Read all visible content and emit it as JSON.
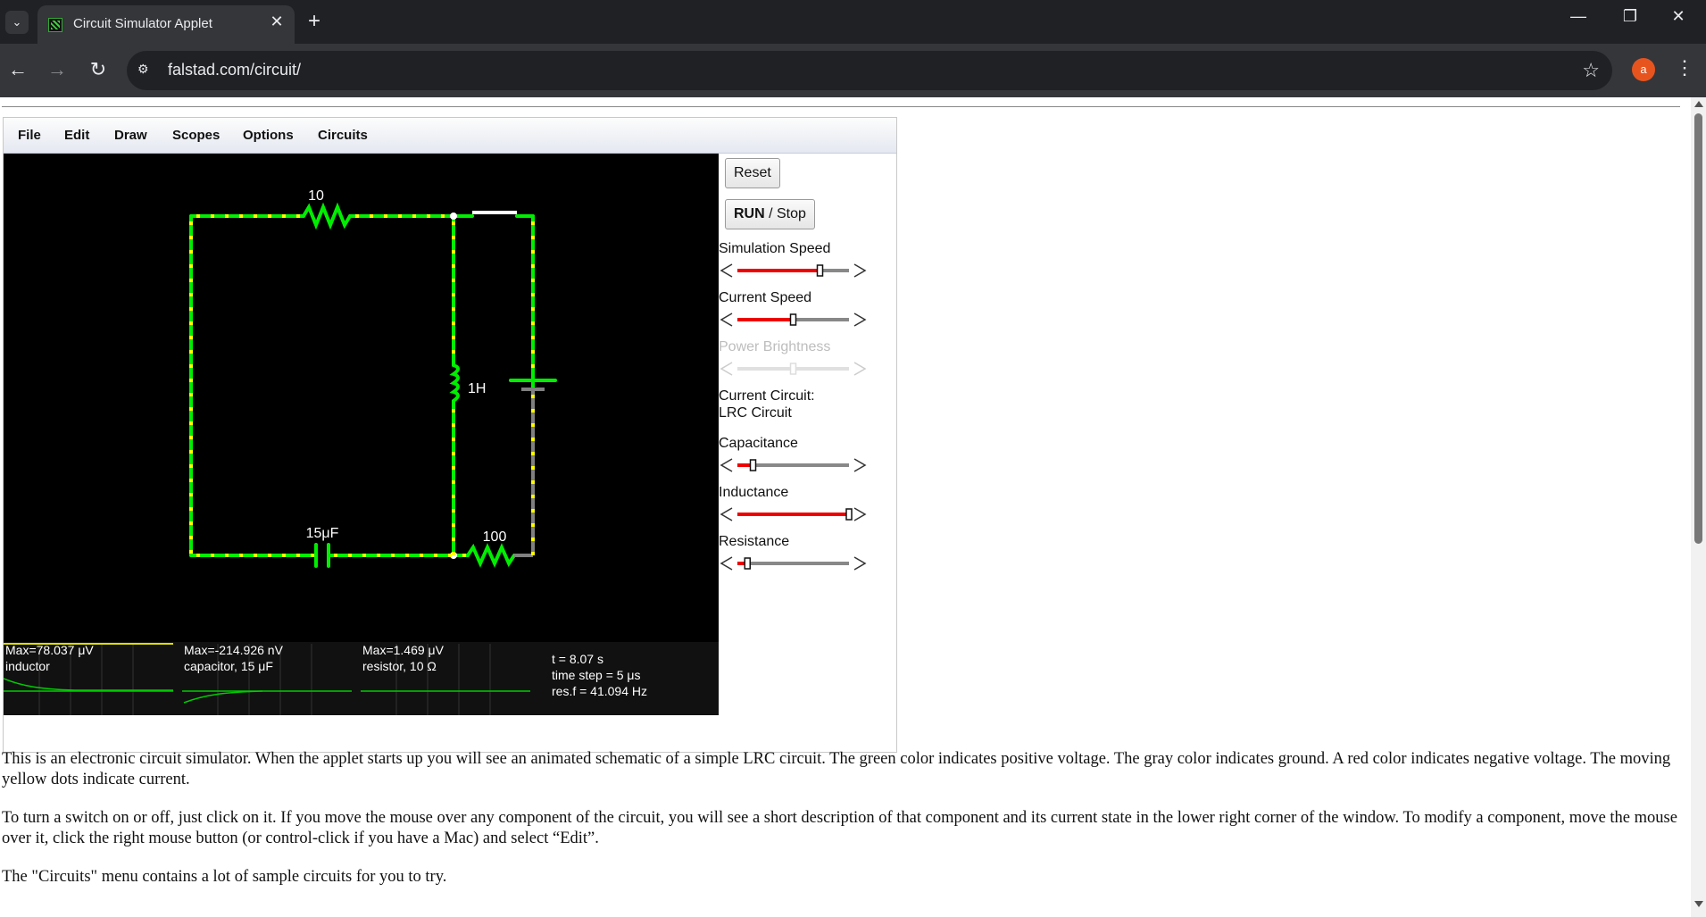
{
  "browser": {
    "tab_title": "Circuit Simulator Applet",
    "tab_close": "✕",
    "new_tab": "+",
    "url": "falstad.com/circuit/",
    "avatar_letter": "a",
    "window_controls": {
      "minimize": "—",
      "restore": "❐",
      "close": "✕"
    }
  },
  "menu": [
    "File",
    "Edit",
    "Draw",
    "Scopes",
    "Options",
    "Circuits"
  ],
  "circuit": {
    "resistor_top_label": "10",
    "inductor_label": "1H",
    "capacitor_label": "15μF",
    "resistor_bottom_label": "100",
    "colors": {
      "positive": "#00ee00",
      "ground": "#808080",
      "current_dots": "#ffff00",
      "background": "#000000"
    }
  },
  "scopes": [
    {
      "max": "Max=78.037 μV",
      "name": "inductor"
    },
    {
      "max": "Max=-214.926 nV",
      "name": "capacitor, 15 μF"
    },
    {
      "max": "Max=1.469 μV",
      "name": "resistor, 10 Ω"
    }
  ],
  "info": {
    "time": "t = 8.07 s",
    "time_step": "time step = 5 μs",
    "res_f": "res.f = 41.094 Hz"
  },
  "controls": {
    "reset_label": "Reset",
    "run_label": "RUN",
    "stop_label": " / Stop",
    "current_circuit_label": "Current Circuit:",
    "current_circuit_name": "LRC Circuit",
    "sliders": [
      {
        "label": "Simulation Speed",
        "level": 0.74,
        "enabled": true
      },
      {
        "label": "Current Speed",
        "level": 0.5,
        "enabled": true
      },
      {
        "label": "Power Brightness",
        "level": 0.5,
        "enabled": false
      },
      {
        "label": "Capacitance",
        "level": 0.14,
        "enabled": true
      },
      {
        "label": "Inductance",
        "level": 1.0,
        "enabled": true
      },
      {
        "label": "Resistance",
        "level": 0.09,
        "enabled": true
      }
    ]
  },
  "paragraphs": [
    "This is an electronic circuit simulator.  When the applet starts up you will see an animated schematic of a simple LRC circuit. The green color indicates positive voltage.  The gray color indicates ground.  A red color indicates negative voltage.  The moving yellow dots indicate current.",
    "To turn a switch on or off, just click on it.  If you move the mouse over any component of the circuit, you will see a short description of that component and its current state in the lower right corner of the window.  To modify a component, move the mouse over it, click the right mouse button (or control-click if you have a Mac) and select “Edit”.",
    "The \"Circuits\" menu contains a lot of sample circuits for you to try."
  ]
}
